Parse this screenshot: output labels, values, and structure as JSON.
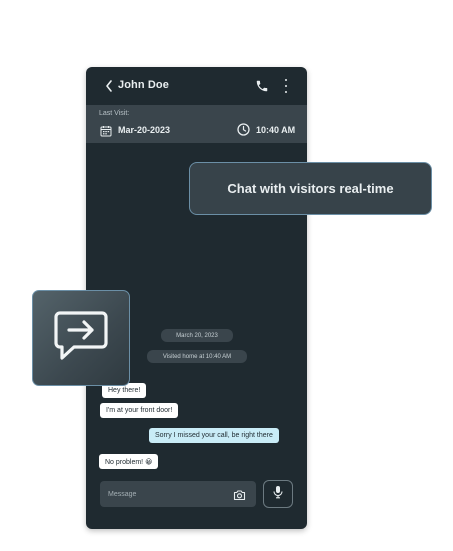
{
  "header": {
    "back_icon": "chevron-left-icon",
    "contact_name": "John Doe",
    "call_icon": "phone-icon",
    "more_icon": "vertical-dots-icon"
  },
  "visit": {
    "label": "Last Visit:",
    "date": "Mar-20-2023",
    "time": "10:40 AM",
    "date_icon": "calendar-icon",
    "time_icon": "clock-icon"
  },
  "timeline": {
    "date_pill": "March 20, 2023",
    "status_pill": "Visited home at 10:40 AM"
  },
  "messages": [
    {
      "text": "Hey there!",
      "from": "visitor"
    },
    {
      "text": "I'm at your front door!",
      "from": "visitor"
    },
    {
      "text": "Sorry I missed your call, be right there",
      "from": "user"
    },
    {
      "text": "No problem! 😀",
      "from": "visitor"
    }
  ],
  "composer": {
    "placeholder": "Message",
    "camera_icon": "camera-icon",
    "mic_icon": "microphone-icon"
  },
  "feature": {
    "caption": "Chat with visitors real-time",
    "tile_icon": "message-forward-icon"
  },
  "colors": {
    "phone_bg": "#1f2a30",
    "bar_bg": "#3a454c",
    "accent_border": "#6b8fa6",
    "sent_bubble": "#c9ecf7",
    "received_bubble": "#ffffff"
  }
}
